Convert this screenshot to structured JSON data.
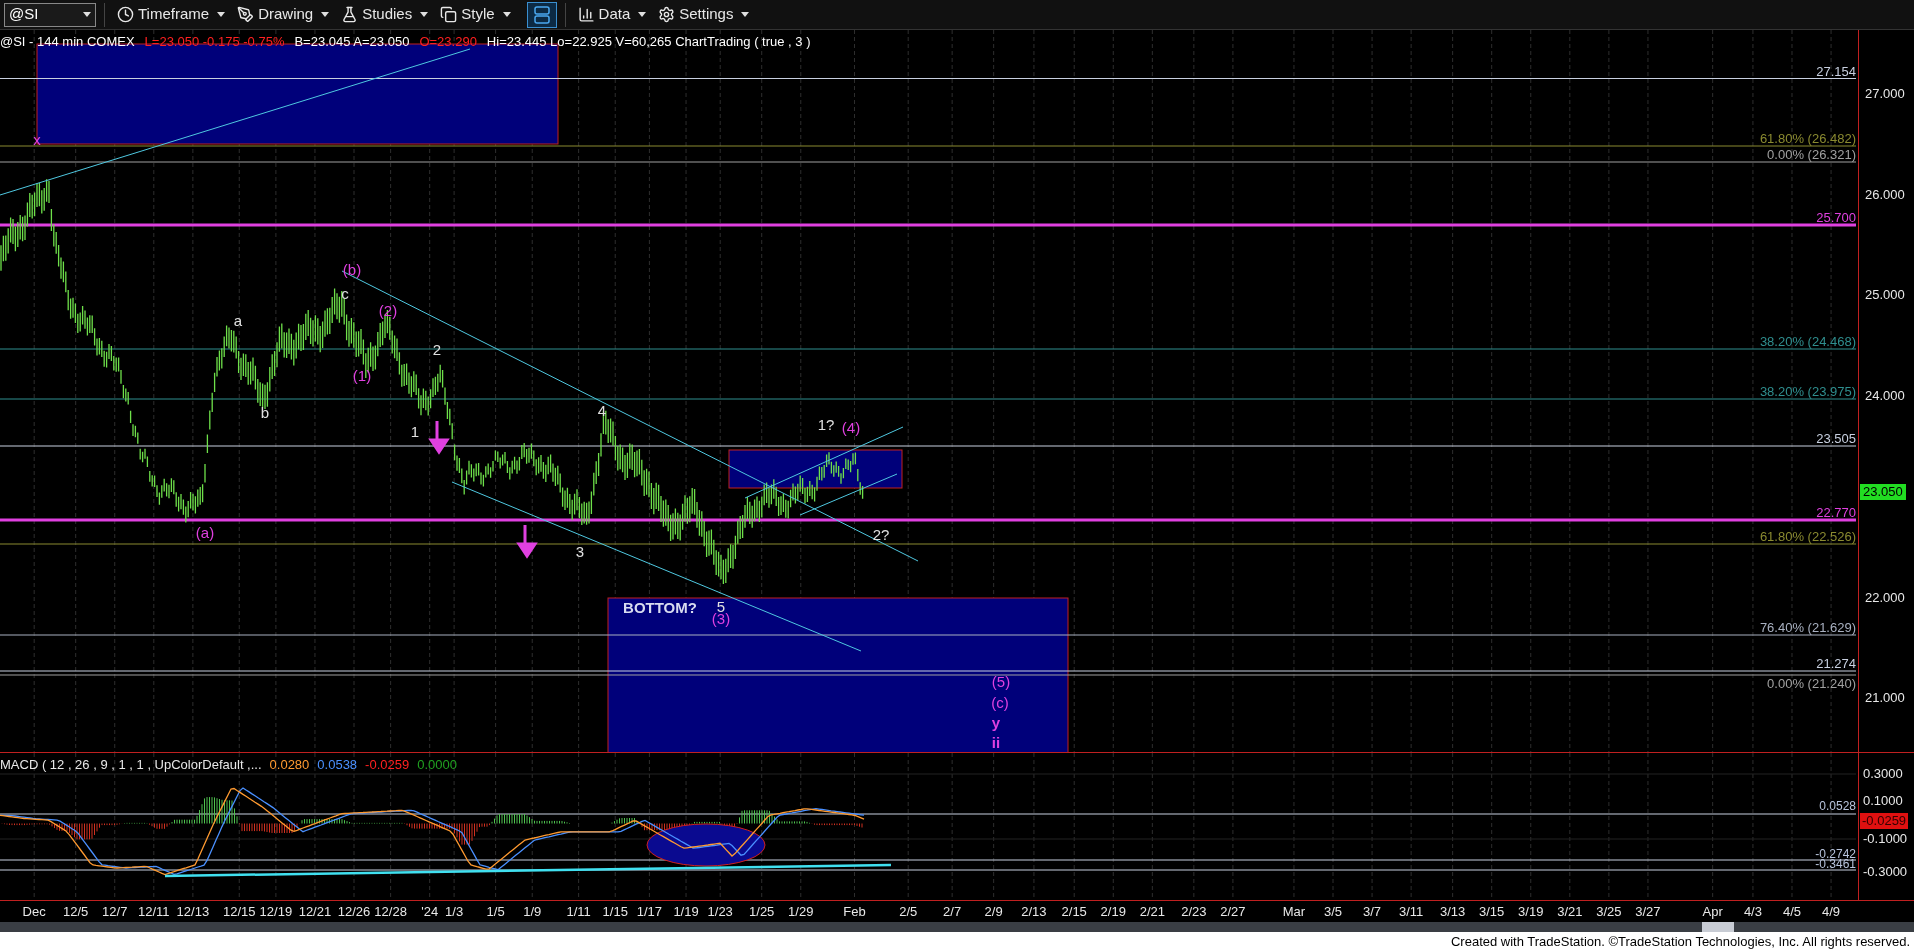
{
  "toolbar": {
    "symbol": "@SI",
    "buttons": [
      {
        "label": "Timeframe"
      },
      {
        "label": "Drawing"
      },
      {
        "label": "Studies"
      },
      {
        "label": "Style"
      }
    ],
    "layout_toggle": {
      "on": true
    },
    "buttons_right": [
      {
        "label": "Data"
      },
      {
        "label": "Settings"
      }
    ]
  },
  "chart": {
    "info_line": [
      {
        "text": "@SI - 144 min  COMEX",
        "color": "#ffffff"
      },
      {
        "text": "L=23.050  -0.175  -0.75%",
        "color": "#ff2020"
      },
      {
        "text": "B=23.045  A=23.050",
        "color": "#ffffff"
      },
      {
        "text": "O=23.290",
        "color": "#ff2020"
      },
      {
        "text": "Hi=23.445  Lo=22.925  V=60,265  ChartTrading ( true , 3 )",
        "color": "#ffffff"
      }
    ],
    "price_levels": [
      {
        "label": "27.154",
        "color": "#c8d0e0"
      },
      {
        "label": "61.80% (26.482)",
        "color": "#8a8a30"
      },
      {
        "label": "0.00% (26.321)",
        "color": "#a0a0a0"
      },
      {
        "label": "25.700",
        "color": "#e040e0"
      },
      {
        "label": "38.20% (24.468)",
        "color": "#2f8f8f"
      },
      {
        "label": "38.20% (23.975)",
        "color": "#2f8f8f"
      },
      {
        "label": "23.505",
        "color": "#c8d0e0"
      },
      {
        "label": "22.770",
        "color": "#e040e0"
      },
      {
        "label": "61.80% (22.526)",
        "color": "#8a8a30"
      },
      {
        "label": "76.40% (21.629)",
        "color": "#a8b0c0"
      },
      {
        "label": "21.274",
        "color": "#c8d0e0"
      },
      {
        "label": "0.00% (21.240)",
        "color": "#a0a0a0"
      }
    ],
    "wave_labels": [
      {
        "text": "x",
        "color": "#e040e0",
        "bold": false
      },
      {
        "text": "(b)",
        "color": "#e040e0",
        "bold": false
      },
      {
        "text": "c",
        "color": "#e0e0e0",
        "bold": false
      },
      {
        "text": "a",
        "color": "#e0e0e0",
        "bold": false
      },
      {
        "text": "b",
        "color": "#e0e0e0",
        "bold": false
      },
      {
        "text": "(2)",
        "color": "#e040e0",
        "bold": false
      },
      {
        "text": "(1)",
        "color": "#e040e0",
        "bold": false
      },
      {
        "text": "2",
        "color": "#e0e0e0",
        "bold": false
      },
      {
        "text": "1",
        "color": "#e0e0e0",
        "bold": false
      },
      {
        "text": "4",
        "color": "#e0e0e0",
        "bold": false
      },
      {
        "text": "3",
        "color": "#e0e0e0",
        "bold": false
      },
      {
        "text": "(a)",
        "color": "#e040e0",
        "bold": false
      },
      {
        "text": "1?",
        "color": "#e0e0e0",
        "bold": false
      },
      {
        "text": "(4)",
        "color": "#e040e0",
        "bold": false
      },
      {
        "text": "2?",
        "color": "#e0e0e0",
        "bold": false
      },
      {
        "text": "BOTTOM?",
        "color": "#d8dcf0",
        "bold": true
      },
      {
        "text": "5",
        "color": "#e0e0e0",
        "bold": false
      },
      {
        "text": "(3)",
        "color": "#e040e0",
        "bold": false
      },
      {
        "text": "(5)",
        "color": "#e040e0",
        "bold": false
      },
      {
        "text": "(c)",
        "color": "#e040e0",
        "bold": false
      },
      {
        "text": "y",
        "color": "#e040e0",
        "bold": true
      },
      {
        "text": "ii",
        "color": "#e040e0",
        "bold": true
      }
    ],
    "price_axis": [
      "27.000",
      "26.000",
      "25.000",
      "24.000",
      "22.000",
      "21.000"
    ],
    "current_price": "23.050"
  },
  "macd": {
    "title": "MACD ( 12 , 26 , 9 , 1 , 1 , UpColorDefault ,...",
    "values": [
      {
        "text": "0.0280",
        "color": "#ff9a30"
      },
      {
        "text": "0.0538",
        "color": "#4a90ff"
      },
      {
        "text": "-0.0259",
        "color": "#ff2020"
      },
      {
        "text": "0.0000",
        "color": "#20a020"
      }
    ],
    "levels": [
      "0.0528",
      "-0.2742",
      "-0.3461"
    ],
    "axis": [
      "0.3000",
      "0.1000",
      "-0.1000",
      "-0.3000"
    ],
    "current_value": "-0.0259"
  },
  "date_axis": [
    "Dec",
    "12/5",
    "12/7",
    "12/11",
    "12/13",
    "12/15",
    "12/19",
    "12/21",
    "12/26",
    "12/28",
    "'24",
    "1/3",
    "1/5",
    "1/9",
    "1/11",
    "1/15",
    "1/17",
    "1/19",
    "1/23",
    "1/25",
    "1/29",
    "Feb",
    "2/5",
    "2/7",
    "2/9",
    "2/13",
    "2/15",
    "2/19",
    "2/21",
    "2/23",
    "2/27",
    "Mar",
    "3/5",
    "3/7",
    "3/11",
    "3/13",
    "3/15",
    "3/19",
    "3/21",
    "3/25",
    "3/27",
    "Apr",
    "4/3",
    "4/5",
    "4/9"
  ],
  "footer": "Created with TradeStation. ©TradeStation Technologies, Inc. All rights reserved."
}
